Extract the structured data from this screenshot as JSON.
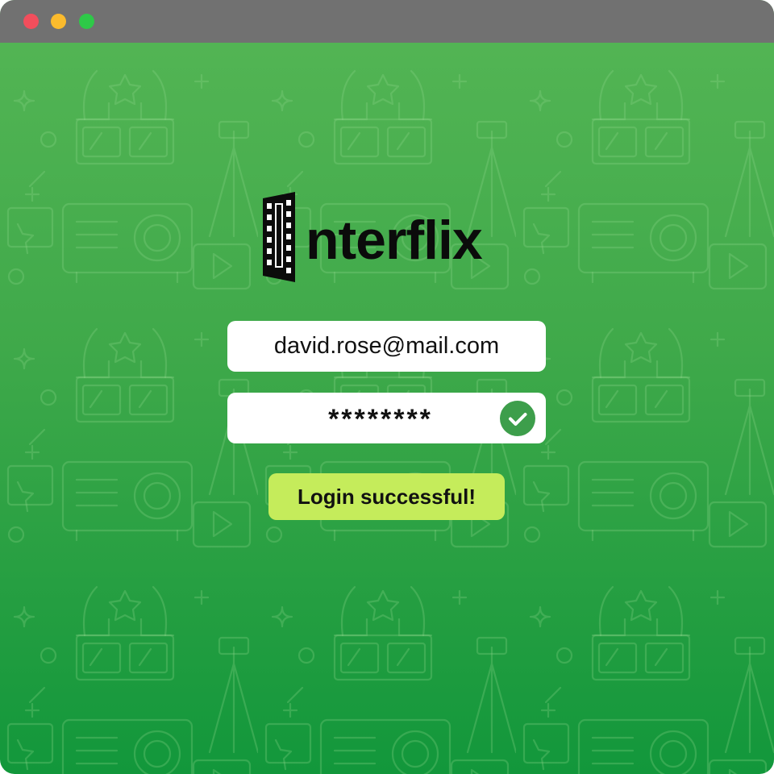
{
  "window": {
    "controls": [
      "close",
      "minimize",
      "maximize"
    ],
    "background_gradient": [
      "#55b655",
      "#12973b"
    ],
    "background_pattern_icons": [
      "3d-glasses-icon",
      "projector-icon",
      "tripod-icon",
      "film-reel-icon",
      "star-icon",
      "play-icon",
      "clapperboard-icon",
      "spotlight-icon"
    ]
  },
  "brand": {
    "name": "Interflix",
    "wordmark_text": "nterflix",
    "logo_icon": "film-strip-icon"
  },
  "login": {
    "email_value": "david.rose@mail.com",
    "password_value": "********",
    "password_status_icon": "check-circle-icon",
    "status_message": "Login successful!",
    "status_color": "#c5ec5b"
  }
}
